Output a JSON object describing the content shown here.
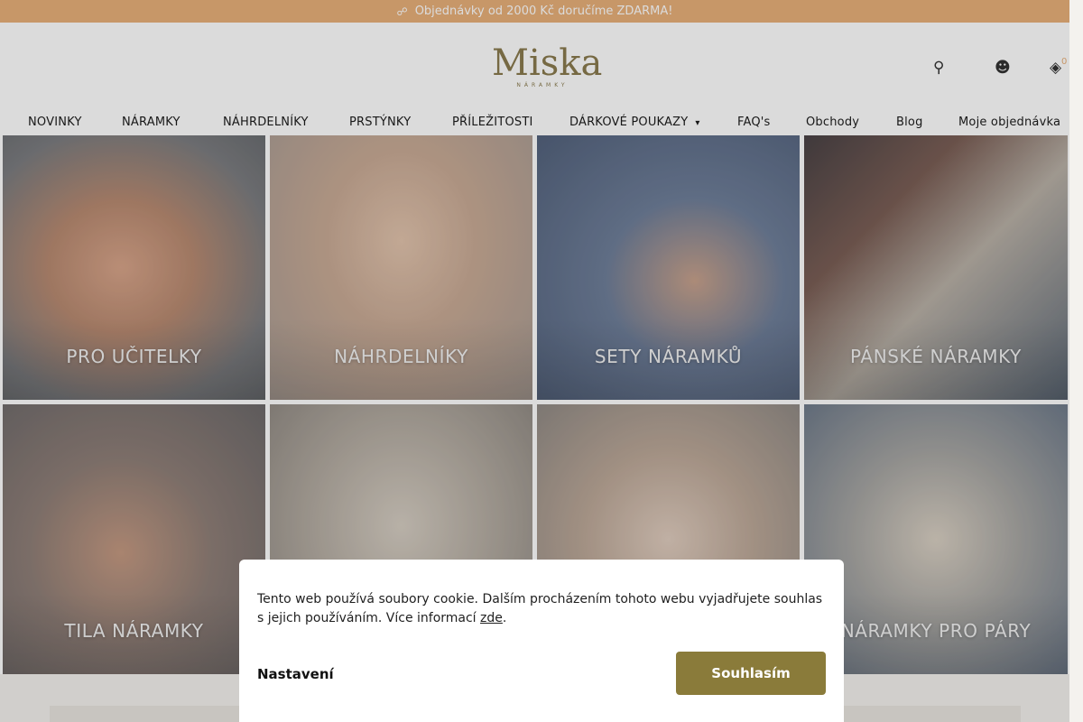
{
  "topbar": {
    "truck_icon": "truck-icon",
    "text": "Objednávky od 2000 Kč doručíme ZDARMA!"
  },
  "logo": {
    "word": "Miska",
    "sub": "NÁRAMKY"
  },
  "header": {
    "search_icon": "search-icon",
    "user_icon": "user-icon",
    "cart_icon": "cart-icon",
    "cart_count": "0"
  },
  "nav": {
    "items": [
      "NOVINKY",
      "NÁRAMKY",
      "NÁHRDELNÍKY",
      "PRSTÝNKY",
      "PŘÍLEŽITOSTI",
      "DÁRKOVÉ POUKAZY",
      "FAQ's",
      "Obchody",
      "Blog",
      "Moje objednávka"
    ]
  },
  "tiles": [
    "PRO UČITELKY",
    "NÁHRDELNÍKY",
    "SETY NÁRAMKŮ",
    "PÁNSKÉ NÁRAMKY",
    "TILA NÁRAMKY",
    "",
    "",
    "NÁRAMKY PRO PÁRY"
  ],
  "cookie": {
    "text_before": "Tento web používá soubory cookie. Dalším procházením tohoto webu vyjadřujete souhlas s jejich používáním. Více informací ",
    "link": "zde",
    "text_after": ".",
    "settings": "Nastavení",
    "agree": "Souhlasím"
  },
  "colors": {
    "topbar": "#e8b07a",
    "brand": "#8a7b3a",
    "logo": "#8a7b4e"
  }
}
